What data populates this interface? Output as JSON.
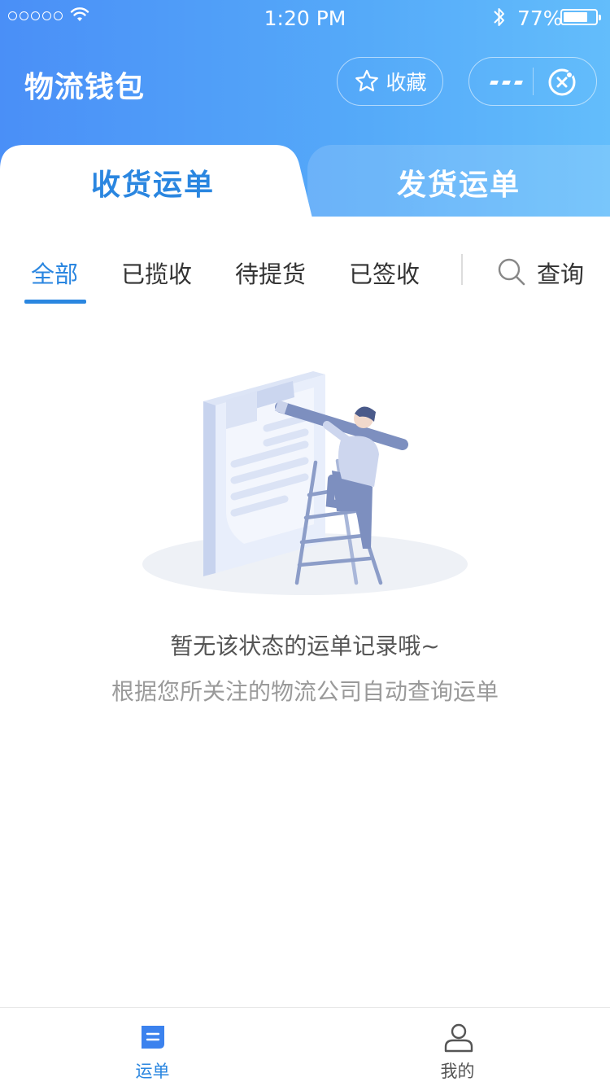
{
  "status_bar": {
    "time": "1:20 PM",
    "battery_percent": "77%",
    "battery_level": 0.77,
    "icons": [
      "signal-dots-icon",
      "wifi-icon",
      "bluetooth-icon",
      "battery-icon"
    ]
  },
  "nav": {
    "title": "物流钱包",
    "favorite_label": "收藏",
    "favorite_icon": "star-icon",
    "more_icon": "more-dots-icon",
    "close_icon": "close-circle-icon"
  },
  "main_tabs": [
    {
      "label": "收货运单",
      "active": true
    },
    {
      "label": "发货运单",
      "active": false
    }
  ],
  "filters": {
    "items": [
      {
        "label": "全部",
        "active": true
      },
      {
        "label": "已揽收",
        "active": false
      },
      {
        "label": "待提货",
        "active": false
      },
      {
        "label": "已签收",
        "active": false
      }
    ],
    "search_label": "查询",
    "search_icon": "search-icon"
  },
  "empty_state": {
    "title": "暂无该状态的运单记录哦~",
    "subtitle": "根据您所关注的物流公司自动查询运单",
    "illustration": "clipboard-ladder-illustration"
  },
  "tab_bar": [
    {
      "label": "运单",
      "icon": "waybill-icon",
      "active": true
    },
    {
      "label": "我的",
      "icon": "user-icon",
      "active": false
    }
  ],
  "colors": {
    "accent": "#2a86e0",
    "header_gradient_start": "#4a8ff7",
    "header_gradient_end": "#63bdfb"
  }
}
